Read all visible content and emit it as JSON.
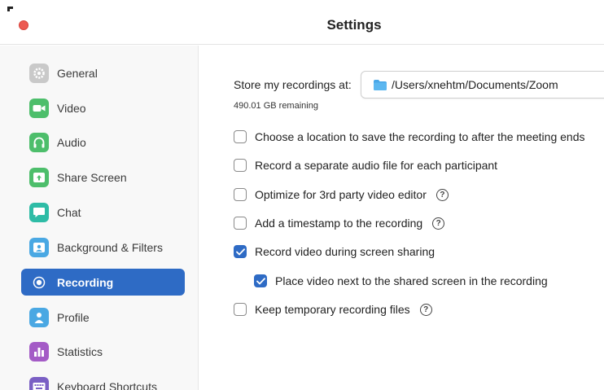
{
  "window": {
    "title": "Settings"
  },
  "colors": {
    "accent": "#2e6bc5",
    "close": "#ec5a52"
  },
  "sidebar": {
    "items": [
      {
        "label": "General",
        "icon": "gear-icon",
        "color": "#c9c9c9",
        "active": false
      },
      {
        "label": "Video",
        "icon": "video-camera-icon",
        "color": "#4dbe6b",
        "active": false
      },
      {
        "label": "Audio",
        "icon": "headphones-icon",
        "color": "#4dbe6b",
        "active": false
      },
      {
        "label": "Share Screen",
        "icon": "share-screen-icon",
        "color": "#4dbe6b",
        "active": false
      },
      {
        "label": "Chat",
        "icon": "chat-bubble-icon",
        "color": "#2ebca6",
        "active": false
      },
      {
        "label": "Background & Filters",
        "icon": "portrait-icon",
        "color": "#4aa8e3",
        "active": false
      },
      {
        "label": "Recording",
        "icon": "record-icon",
        "color": "#2e6bc5",
        "active": true
      },
      {
        "label": "Profile",
        "icon": "person-icon",
        "color": "#4aa8e3",
        "active": false
      },
      {
        "label": "Statistics",
        "icon": "bar-chart-icon",
        "color": "#a45bc6",
        "active": false
      },
      {
        "label": "Keyboard Shortcuts",
        "icon": "keyboard-icon",
        "color": "#7a5fc4",
        "active": false
      }
    ]
  },
  "recording": {
    "store_label": "Store my recordings at:",
    "path": "/Users/xnehtm/Documents/Zoom",
    "remaining": "490.01 GB remaining",
    "options": [
      {
        "label": "Choose a location to save the recording to after the meeting ends",
        "checked": false,
        "help": false,
        "indent": false
      },
      {
        "label": "Record a separate audio file for each participant",
        "checked": false,
        "help": false,
        "indent": false
      },
      {
        "label": "Optimize for 3rd party video editor",
        "checked": false,
        "help": true,
        "indent": false
      },
      {
        "label": "Add a timestamp to the recording",
        "checked": false,
        "help": true,
        "indent": false
      },
      {
        "label": "Record video during screen sharing",
        "checked": true,
        "help": false,
        "indent": false
      },
      {
        "label": "Place video next to the shared screen in the recording",
        "checked": true,
        "help": false,
        "indent": true
      },
      {
        "label": "Keep temporary recording files",
        "checked": false,
        "help": true,
        "indent": false
      }
    ]
  }
}
